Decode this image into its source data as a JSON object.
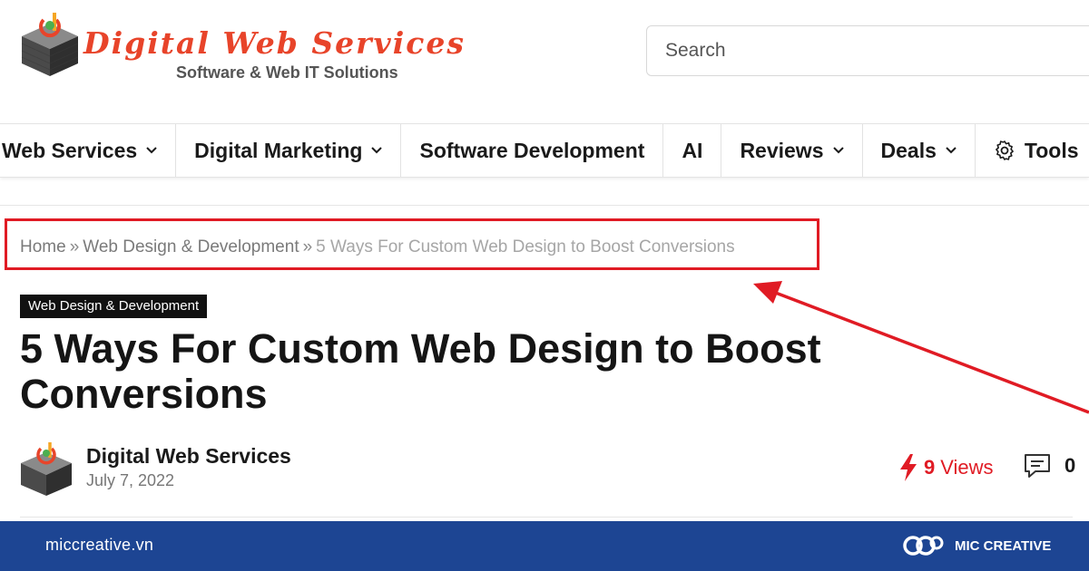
{
  "header": {
    "logo_title": "Digital Web Services",
    "logo_subtitle": "Software & Web IT Solutions",
    "search_placeholder": "Search"
  },
  "nav": {
    "items": [
      {
        "label": "Web Services",
        "dropdown": true
      },
      {
        "label": "Digital Marketing",
        "dropdown": true
      },
      {
        "label": "Software Development",
        "dropdown": false
      },
      {
        "label": "AI",
        "dropdown": false
      },
      {
        "label": "Reviews",
        "dropdown": true
      },
      {
        "label": "Deals",
        "dropdown": true
      },
      {
        "label": "Tools",
        "icon": "gear-icon"
      }
    ]
  },
  "breadcrumb": {
    "home": "Home",
    "separator": "»",
    "category": "Web Design & Development",
    "current": "5 Ways For Custom Web Design to Boost Conversions"
  },
  "article": {
    "category_badge": "Web Design & Development",
    "title": "5 Ways For Custom Web Design to Boost Conversions",
    "author": "Digital Web Services",
    "date": "July 7, 2022",
    "views_count": "9",
    "views_label": "Views",
    "comments_count": "0"
  },
  "annotation": {
    "highlight_color": "#e01b24"
  },
  "footer": {
    "site_url": "miccreative.vn",
    "brand_name": "MIC CREATIVE",
    "background": "#1d4593"
  },
  "icons": [
    "logo-cube-icon",
    "chevron-down-icon",
    "gear-icon",
    "bolt-icon",
    "comment-icon",
    "mic-creative-logo-icon"
  ]
}
